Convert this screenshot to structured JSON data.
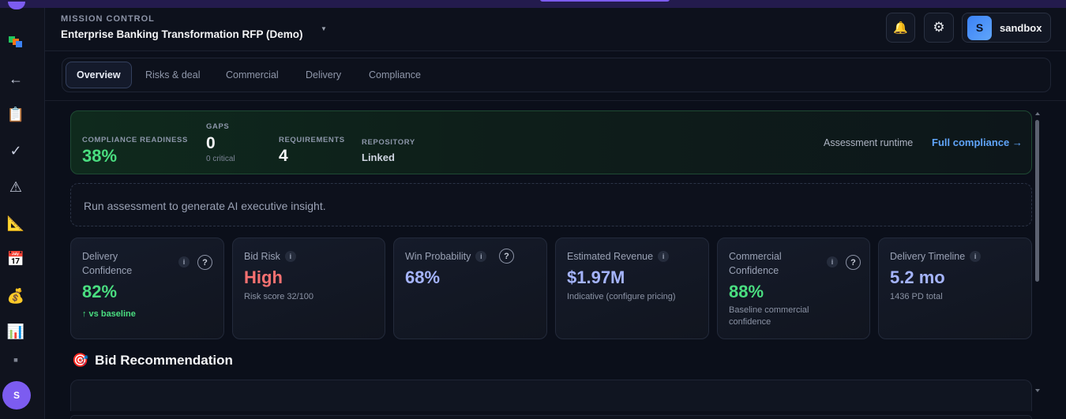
{
  "header": {
    "eyebrow": "MISSION CONTROL",
    "title": "Enterprise Banking Transformation RFP (Demo)",
    "user": {
      "initial": "S",
      "name": "sandbox"
    }
  },
  "rail": {
    "items": [
      {
        "icon": "stacked-squares-icon",
        "glyph": "▦"
      },
      {
        "icon": "back-arrow-icon",
        "glyph": "←"
      },
      {
        "icon": "clipboard-icon",
        "glyph": "📋"
      },
      {
        "icon": "checkmark-icon",
        "glyph": "✓"
      },
      {
        "icon": "warning-icon",
        "glyph": "⚠"
      },
      {
        "icon": "triangle-ruler-icon",
        "glyph": "📐"
      },
      {
        "icon": "calendar-icon",
        "glyph": "📅"
      },
      {
        "icon": "money-bag-icon",
        "glyph": "💰"
      },
      {
        "icon": "bar-chart-icon",
        "glyph": "📊"
      }
    ],
    "avatar": "S"
  },
  "tabs": [
    "Overview",
    "Risks & deal",
    "Commercial",
    "Delivery",
    "Compliance"
  ],
  "active_tab": "Overview",
  "compliance": {
    "readiness_label": "COMPLIANCE READINESS",
    "readiness_value": "38%",
    "gaps_label": "GAPS",
    "gaps_value": "0",
    "gaps_sub": "0 critical",
    "requirements_label": "REQUIREMENTS",
    "requirements_value": "4",
    "repository_label": "REPOSITORY",
    "repository_value": "Linked",
    "runtime_label": "Assessment runtime",
    "link_label": "Full compliance →"
  },
  "insight": "Run assessment to generate AI executive insight.",
  "cards": [
    {
      "label": "Delivery Confidence",
      "value": "82%",
      "sub": "↑ vs baseline",
      "value_color": "#4ade80",
      "sub_color": "#4ade80"
    },
    {
      "label": "Bid Risk",
      "value": "High",
      "sub": "Risk score 32/100",
      "value_color": "#f87171"
    },
    {
      "label": "Win Probability",
      "value": "68%",
      "sub": "",
      "value_color": "#a5b4fc"
    },
    {
      "label": "Estimated Revenue",
      "value": "$1.97M",
      "sub": "Indicative (configure pricing)",
      "value_color": "#a5b4fc"
    },
    {
      "label": "Commercial Confidence",
      "value": "88%",
      "sub": "Baseline commercial confidence",
      "value_color": "#4ade80"
    },
    {
      "label": "Delivery Timeline",
      "value": "5.2 mo",
      "sub": "1436 PD total",
      "value_color": "#a5b4fc"
    }
  ],
  "info_glyph": "i",
  "help_glyph": "?",
  "section": {
    "icon": "🎯",
    "title": "Bid Recommendation"
  },
  "colors": {
    "accent": "#7c5cf0",
    "success": "#4ade80",
    "danger": "#f87171",
    "indigo": "#a5b4fc",
    "link": "#60a5fa"
  }
}
